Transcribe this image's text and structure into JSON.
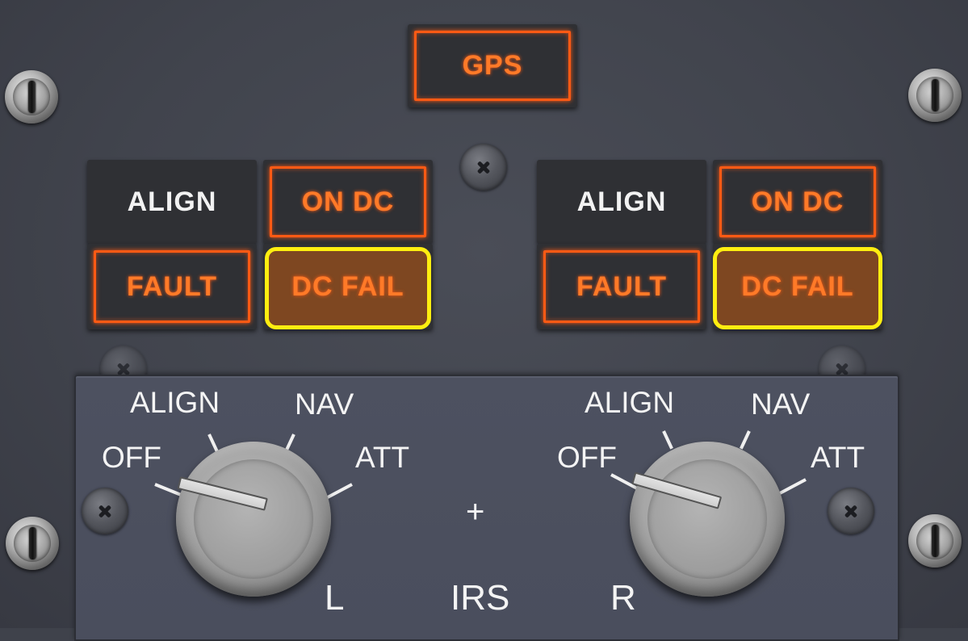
{
  "panel": {
    "gps_light": {
      "label": "GPS",
      "state": "illuminated",
      "color": "#ff5a14"
    },
    "irs_left": {
      "align": {
        "label": "ALIGN",
        "state": "off"
      },
      "on_dc": {
        "label": "ON DC",
        "state": "illuminated"
      },
      "fault": {
        "label": "FAULT",
        "state": "illuminated"
      },
      "dc_fail": {
        "label": "DC FAIL",
        "state": "illuminated",
        "highlighted": true
      }
    },
    "irs_right": {
      "align": {
        "label": "ALIGN",
        "state": "off"
      },
      "on_dc": {
        "label": "ON DC",
        "state": "illuminated"
      },
      "fault": {
        "label": "FAULT",
        "state": "illuminated"
      },
      "dc_fail": {
        "label": "DC FAIL",
        "state": "illuminated",
        "highlighted": true
      }
    },
    "mode_selector_left": {
      "positions": [
        "OFF",
        "ALIGN",
        "NAV",
        "ATT"
      ],
      "current": "OFF",
      "side_label": "L"
    },
    "mode_selector_right": {
      "positions": [
        "OFF",
        "ALIGN",
        "NAV",
        "ATT"
      ],
      "current": "OFF",
      "side_label": "R"
    },
    "center_label": "IRS",
    "center_mark": "+",
    "colors": {
      "annunciator": "#ff5a14",
      "highlight": "#ffee10",
      "panel": "#41444d"
    }
  }
}
